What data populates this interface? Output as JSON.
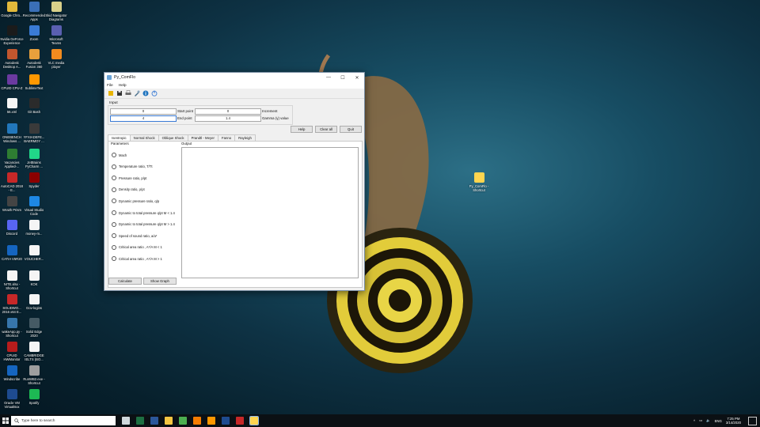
{
  "desktop": {
    "left_icons": [
      {
        "label": "Google Chro...",
        "color": "#e2b93b"
      },
      {
        "label": "Recommended Apps",
        "color": "#3a6fb7"
      },
      {
        "label": "Skid Navigator Diagrams",
        "color": "#d9d08a"
      },
      {
        "label": "Nvidia GeForce Experience",
        "color": "#1b1b1b"
      },
      {
        "label": "Zoom",
        "color": "#3a7bd5"
      },
      {
        "label": "Microsoft Teams",
        "color": "#5a5fb0"
      },
      {
        "label": "Autodesk Desktop A...",
        "color": "#c2562e"
      },
      {
        "label": "Autodesk Fusion 360",
        "color": "#e8a03c"
      },
      {
        "label": "VLC media player",
        "color": "#f28b1f"
      },
      {
        "label": "CPUID CPU-Z",
        "color": "#6b3aa0"
      },
      {
        "label": "SublimeText",
        "color": "#ff9800"
      },
      {
        "label": "56.xml",
        "color": "#f5f5f5"
      },
      {
        "label": "Git Bash",
        "color": "#2b2b2b"
      },
      {
        "label": "ONEBENCH Windows ...",
        "color": "#2277bb"
      },
      {
        "label": "YFXIADEFE... BAERMOY ...",
        "color": "#3a3a3a"
      },
      {
        "label": "Vacancies Applied-...",
        "color": "#2e7d32"
      },
      {
        "label": "JetBrains PyCharm ...",
        "color": "#21d789"
      },
      {
        "label": "AutoCAD 2018 - E...",
        "color": "#c62828"
      },
      {
        "label": "Spyder",
        "color": "#8b0000"
      },
      {
        "label": "Wraith Prism",
        "color": "#444444"
      },
      {
        "label": "Visual Studio Code",
        "color": "#1e88e5"
      },
      {
        "label": "Discord",
        "color": "#5865f2"
      },
      {
        "label": "money-m...",
        "color": "#f5f5f5"
      },
      {
        "label": "CATIA V5R20",
        "color": "#1565c0"
      },
      {
        "label": "VOUCHER...",
        "color": "#f5f5f5"
      },
      {
        "label": "NITE.xlsx - Shortcut",
        "color": "#f5f5f5"
      },
      {
        "label": "KOK",
        "color": "#f5f5f5"
      },
      {
        "label": "SOLIDWO... 2016 x64 E...",
        "color": "#c62828"
      },
      {
        "label": "Gov-logins",
        "color": "#f5f5f5"
      },
      {
        "label": "wakeApp.py - Shortcut",
        "color": "#3776ab"
      },
      {
        "label": "Solid Edge 2020",
        "color": "#455a64"
      },
      {
        "label": "CPUID HWMonitor",
        "color": "#b71c1c"
      },
      {
        "label": "CAMBRIDGE IELTS (BO...",
        "color": "#f5f5f5"
      },
      {
        "label": "Windscribe",
        "color": "#1565c0"
      },
      {
        "label": "RunWB2.exe - Shortcut",
        "color": "#9e9e9e"
      },
      {
        "label": "Oracle VM VirtualBox",
        "color": "#1e4b8f"
      },
      {
        "label": "Spotify",
        "color": "#1db954"
      }
    ],
    "right_shortcut": {
      "label": "Py_ComFlo - Shortcut",
      "color": "#ffd54f"
    }
  },
  "window": {
    "title": "Py_ComFlo",
    "controls": {
      "minimize": "—",
      "maximize": "☐",
      "close": "✕"
    },
    "menu": [
      "File",
      "Help"
    ],
    "toolbar": [
      {
        "name": "open-icon",
        "color": "#e8b400"
      },
      {
        "name": "save-icon",
        "color": "#333333"
      },
      {
        "name": "print-icon",
        "color": "#666666"
      },
      {
        "name": "settings-icon",
        "color": "#4a6f8a"
      },
      {
        "name": "info-icon",
        "color": "#1e73be"
      },
      {
        "name": "power-icon",
        "color": "#3a7bd5"
      }
    ],
    "input": {
      "label": "Input",
      "start_value": "0",
      "start_label": "Start point",
      "increment_value": "0",
      "increment_label": "Increment",
      "end_value": "4",
      "end_label": "End point",
      "gamma_value": "1.4",
      "gamma_label": "Gamma (γ) value"
    },
    "buttons": {
      "help": "Help",
      "clear_all": "Clear all",
      "quit": "Quit",
      "calculate": "Calculate",
      "show_graph": "Show Graph"
    },
    "tabs": [
      "Isentropic",
      "Normal Shock",
      "Oblique Shock",
      "Prandtl - Meyer",
      "Fanno",
      "Rayleigh"
    ],
    "selected_tab": 0,
    "parameters_label": "Parameters",
    "parameters": [
      "Mach",
      "Temperature ratio, T/Tt",
      "Pressure ratio, p/pt",
      "Density ratio, ρ/ρt",
      "Dynamic pressure ratio, q/p",
      "Dynamic to total pressure q/pt M < 1.4",
      "Dynamic to total pressure q/pt M > 1.4",
      "Speed of sound ratio, a/a*",
      "Critical area ratio , A*/A M < 1",
      "Critical area ratio , A*/A M > 1"
    ],
    "output_label": "Output"
  },
  "taskbar": {
    "search_placeholder": "Type here to search",
    "apps": [
      {
        "name": "task-view-icon",
        "color": "#cfd8dc"
      },
      {
        "name": "excel-icon",
        "color": "#1d6f42"
      },
      {
        "name": "word-icon",
        "color": "#2b579a"
      },
      {
        "name": "file-explorer-icon",
        "color": "#f4c542"
      },
      {
        "name": "chrome-icon",
        "color": "#4caf50"
      },
      {
        "name": "blender-icon",
        "color": "#f57c00"
      },
      {
        "name": "sublime-icon",
        "color": "#ff9800"
      },
      {
        "name": "virtualbox-icon",
        "color": "#1e4b8f"
      },
      {
        "name": "app-red-icon",
        "color": "#c62828"
      },
      {
        "name": "py-comflo-icon",
        "color": "#ffd54f"
      }
    ],
    "language": "ENG",
    "time": "7:25 PM",
    "date": "3/14/2020"
  }
}
